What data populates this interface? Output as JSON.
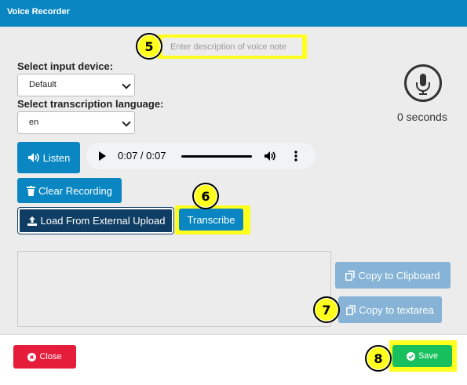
{
  "window": {
    "title": "Voice Recorder"
  },
  "description": {
    "placeholder": "Enter description of voice note"
  },
  "badges": {
    "b5": "5",
    "b6": "6",
    "b7": "7",
    "b8": "8"
  },
  "input_device": {
    "label": "Select input device:",
    "selected": "Default"
  },
  "language": {
    "label": "Select transcription language:",
    "selected": "en"
  },
  "recorder": {
    "duration_text": "0 seconds"
  },
  "audio": {
    "time": "0:07 / 0:07"
  },
  "buttons": {
    "listen": "Listen",
    "clear": "Clear Recording",
    "load": "Load From External Upload",
    "transcribe": "Transcribe",
    "copy_clipboard": "Copy to Clipboard",
    "copy_textarea": "Copy to textarea",
    "close": "Close",
    "save": "Save"
  },
  "icons": {
    "mic": "microphone-icon",
    "listen": "volume-icon",
    "clear": "trash-icon",
    "load": "upload-icon",
    "copy": "copy-icon",
    "close": "times-circle-icon",
    "save": "check-circle-icon"
  },
  "colors": {
    "header": "#0a87c2",
    "primary": "#0a87c2",
    "dark": "#0f3d63",
    "disabled": "#86b3d6",
    "danger": "#e51c3a",
    "success": "#17c05d",
    "highlight": "#ffff1e"
  }
}
